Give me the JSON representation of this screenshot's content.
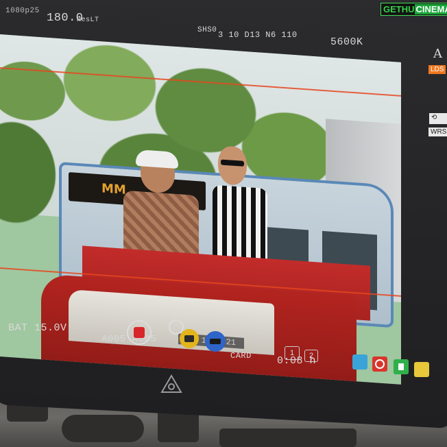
{
  "watermark": {
    "brand_left": "GETHU",
    "brand_right": "CINEMA"
  },
  "top_hud": {
    "fps": "1080p25",
    "shutter": "180.0",
    "res_label": "ResLT",
    "codec": "SHS0",
    "clip_code": "3 10 D13 N6 110",
    "white_balance": "5600K",
    "aspect": "A"
  },
  "side_buttons": [
    {
      "label": "LDS",
      "color": "#f07820"
    },
    {
      "label": "WRS",
      "color": "#e8e8e8"
    }
  ],
  "frame": {
    "timecode_overlay": "02 12 2021",
    "bus_sign": "MM"
  },
  "bottom_hud": {
    "battery": "BAT 15.0V",
    "clip": "A005 A005",
    "media": "CARD",
    "remaining": "0:08 h",
    "slot_a": "1",
    "slot_b": "2"
  },
  "colors": {
    "record": "#d8262a",
    "yellow_button": "#e3b41c",
    "blue_button": "#2f64c8",
    "accent_cyan": "#3aa4d8",
    "accent_red": "#d8352c",
    "accent_green": "#2fb04a",
    "accent_yellow": "#e6c83a"
  },
  "icons": [
    "record-icon",
    "circle-icon",
    "yellow-button-icon",
    "blue-button-icon",
    "cyan-square-icon",
    "red-target-icon",
    "green-flag-icon",
    "yellow-square-icon",
    "atomos-logo-icon",
    "refresh-icon"
  ]
}
